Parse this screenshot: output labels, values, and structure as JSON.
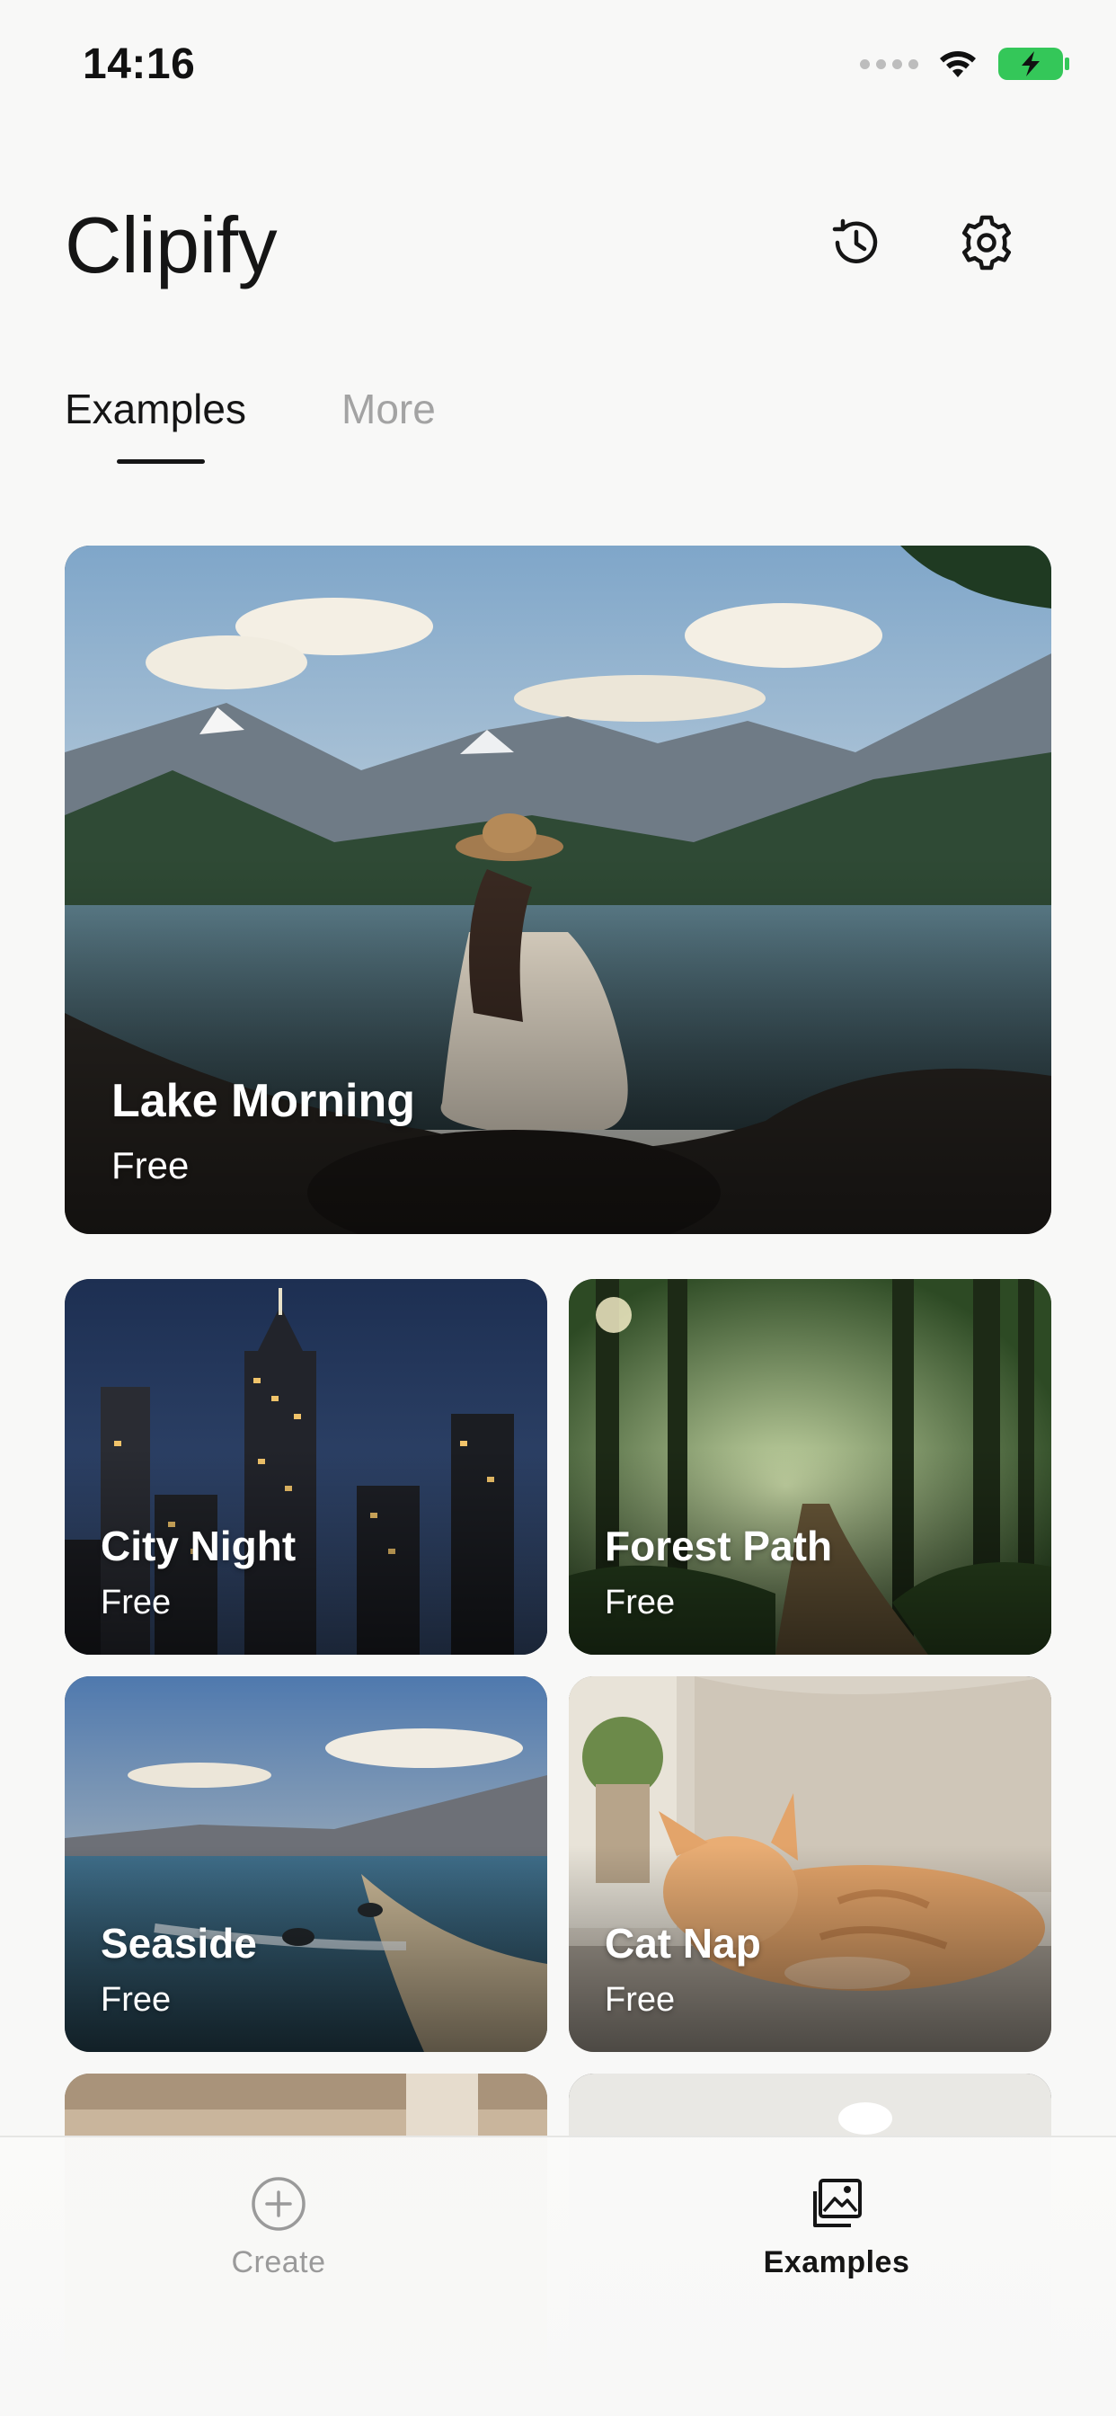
{
  "status_bar": {
    "time": "14:16",
    "icons": [
      "signal-dots-icon",
      "wifi-icon",
      "battery-charging-icon"
    ],
    "battery_color": "#34c759"
  },
  "header": {
    "title": "Clipify",
    "actions": [
      "history-icon",
      "gear-icon"
    ]
  },
  "tabs": [
    {
      "label": "Examples",
      "active": true
    },
    {
      "label": "More",
      "active": false
    }
  ],
  "featured": {
    "title": "Lake Morning",
    "price": "Free"
  },
  "grid": [
    {
      "title": "City Night",
      "price": "Free"
    },
    {
      "title": "Forest Path",
      "price": "Free"
    },
    {
      "title": "Seaside",
      "price": "Free"
    },
    {
      "title": "Cat Nap",
      "price": "Free"
    },
    {
      "title": "",
      "price": ""
    },
    {
      "title": "",
      "price": ""
    }
  ],
  "bottom_nav": [
    {
      "label": "Create",
      "icon": "plus-circle-icon",
      "active": false
    },
    {
      "label": "Examples",
      "icon": "photo-gallery-icon",
      "active": true
    }
  ]
}
